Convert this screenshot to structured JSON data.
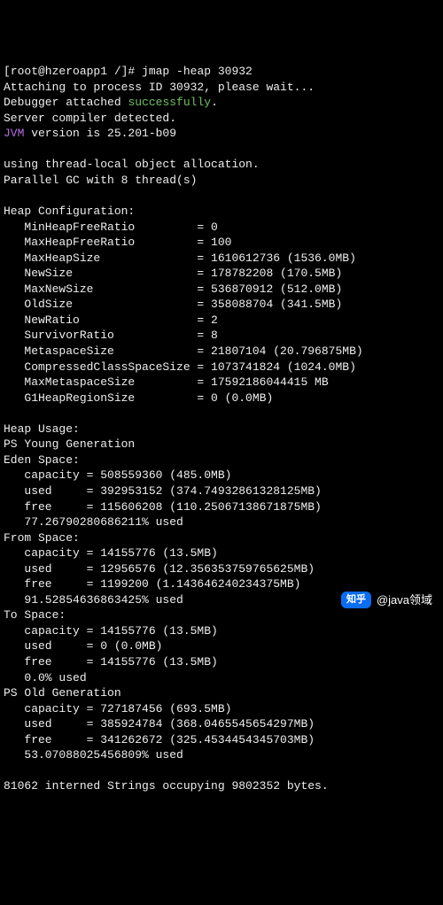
{
  "prompt": {
    "user": "root",
    "host": "hzeroapp1",
    "path": "/",
    "command": "jmap -heap 30932"
  },
  "attach_line": "Attaching to process ID 30932, please wait...",
  "debugger_prefix": "Debugger attached ",
  "debugger_success": "successfully",
  "server_line": "Server compiler detected.",
  "jvm_prefix": "JVM",
  "jvm_rest": " version is 25.201-b09",
  "allocation_line": "using thread-local object allocation.",
  "parallel_line": "Parallel GC with 8 thread(s)",
  "heap_config_header": "Heap Configuration:",
  "heap_config": [
    "   MinHeapFreeRatio         = 0",
    "   MaxHeapFreeRatio         = 100",
    "   MaxHeapSize              = 1610612736 (1536.0MB)",
    "   NewSize                  = 178782208 (170.5MB)",
    "   MaxNewSize               = 536870912 (512.0MB)",
    "   OldSize                  = 358088704 (341.5MB)",
    "   NewRatio                 = 2",
    "   SurvivorRatio            = 8",
    "   MetaspaceSize            = 21807104 (20.796875MB)",
    "   CompressedClassSpaceSize = 1073741824 (1024.0MB)",
    "   MaxMetaspaceSize         = 17592186044415 MB",
    "   G1HeapRegionSize         = 0 (0.0MB)"
  ],
  "heap_usage_header": "Heap Usage:",
  "sections": [
    {
      "title": "PS Young Generation",
      "label": "Eden Space:",
      "lines": [
        "   capacity = 508559360 (485.0MB)",
        "   used     = 392953152 (374.74932861328125MB)",
        "   free     = 115606208 (110.25067138671875MB)",
        "   77.26790280686211% used"
      ]
    },
    {
      "label": "From Space:",
      "lines": [
        "   capacity = 14155776 (13.5MB)",
        "   used     = 12956576 (12.356353759765625MB)",
        "   free     = 1199200 (1.143646240234375MB)",
        "   91.52854636863425% used"
      ]
    },
    {
      "label": "To Space:",
      "lines": [
        "   capacity = 14155776 (13.5MB)",
        "   used     = 0 (0.0MB)",
        "   free     = 14155776 (13.5MB)",
        "   0.0% used"
      ]
    },
    {
      "title": "PS Old Generation",
      "lines": [
        "   capacity = 727187456 (693.5MB)",
        "   used     = 385924784 (368.0465545654297MB)",
        "   free     = 341262672 (325.4534454345703MB)",
        "   53.07088025456809% used"
      ]
    }
  ],
  "footer_line": "81062 interned Strings occupying 9802352 bytes.",
  "watermark": {
    "badge": "知乎",
    "author": "@java领域"
  }
}
